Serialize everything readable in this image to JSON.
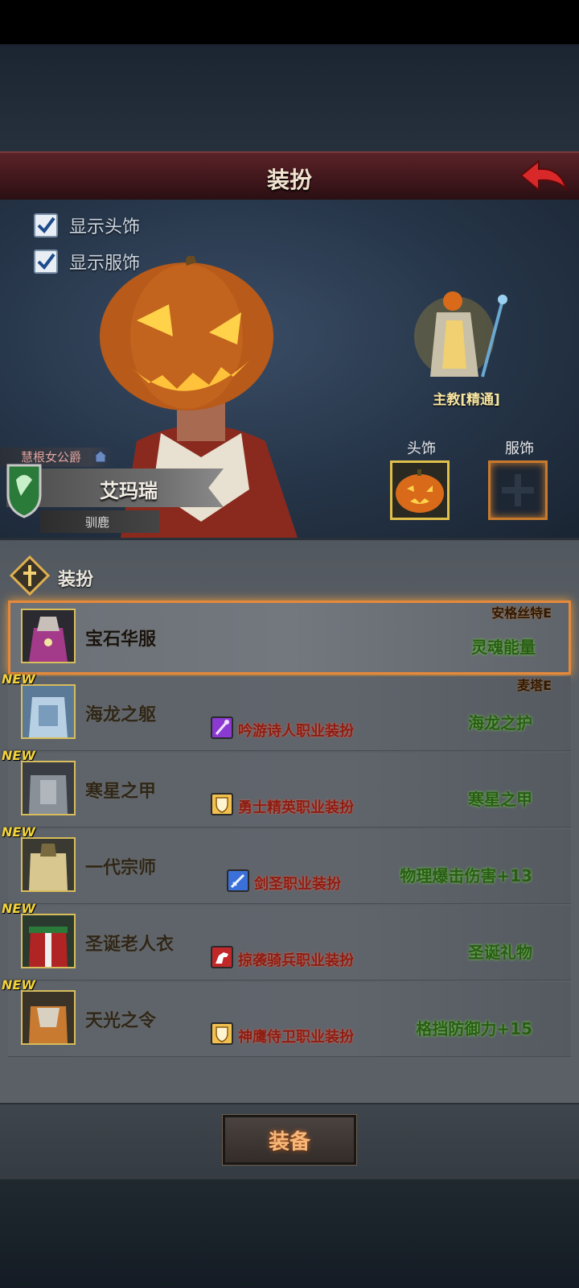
{
  "header": {
    "title": "装扮",
    "back_icon": "back-arrow-icon"
  },
  "preview": {
    "show_headwear": {
      "label": "显示头饰",
      "checked": true
    },
    "show_outfit": {
      "label": "显示服饰",
      "checked": true
    },
    "avatar": {
      "title": "慧根女公爵",
      "name": "艾玛瑞",
      "subtitle": "驯鹿"
    },
    "class_label": "主教[精通]",
    "slots": {
      "head_label": "头饰",
      "body_label": "服饰"
    }
  },
  "section": {
    "title": "装扮"
  },
  "items": [
    {
      "name": "宝石华服",
      "source": "安格丝特E",
      "effect": "灵魂能量",
      "new": "",
      "tag": "",
      "selected": true
    },
    {
      "name": "海龙之躯",
      "source": "麦塔E",
      "effect": "海龙之护",
      "new": "NEW",
      "tag": "吟游诗人职业装扮",
      "tag_icon": "staff-icon",
      "tag_color": "#8a3ad0"
    },
    {
      "name": "寒星之甲",
      "source": "",
      "effect": "寒星之甲",
      "new": "NEW",
      "tag": "勇士精英职业装扮",
      "tag_icon": "shield-icon",
      "tag_color": "#e8b548"
    },
    {
      "name": "一代宗师",
      "source": "",
      "effect": "物理爆击伤害+13",
      "new": "NEW",
      "tag": "剑圣职业装扮",
      "tag_icon": "sword-icon",
      "tag_color": "#3a70d8"
    },
    {
      "name": "圣诞老人衣",
      "source": "",
      "effect": "圣诞礼物",
      "new": "NEW",
      "tag": "掠袭骑兵职业装扮",
      "tag_icon": "horse-icon",
      "tag_color": "#c0282a"
    },
    {
      "name": "天光之令",
      "source": "",
      "effect": "格挡防御力+15",
      "new": "NEW",
      "tag": "神鹰侍卫职业装扮",
      "tag_icon": "shield-icon",
      "tag_color": "#e8b548"
    }
  ],
  "footer": {
    "equip_label": "装备"
  }
}
